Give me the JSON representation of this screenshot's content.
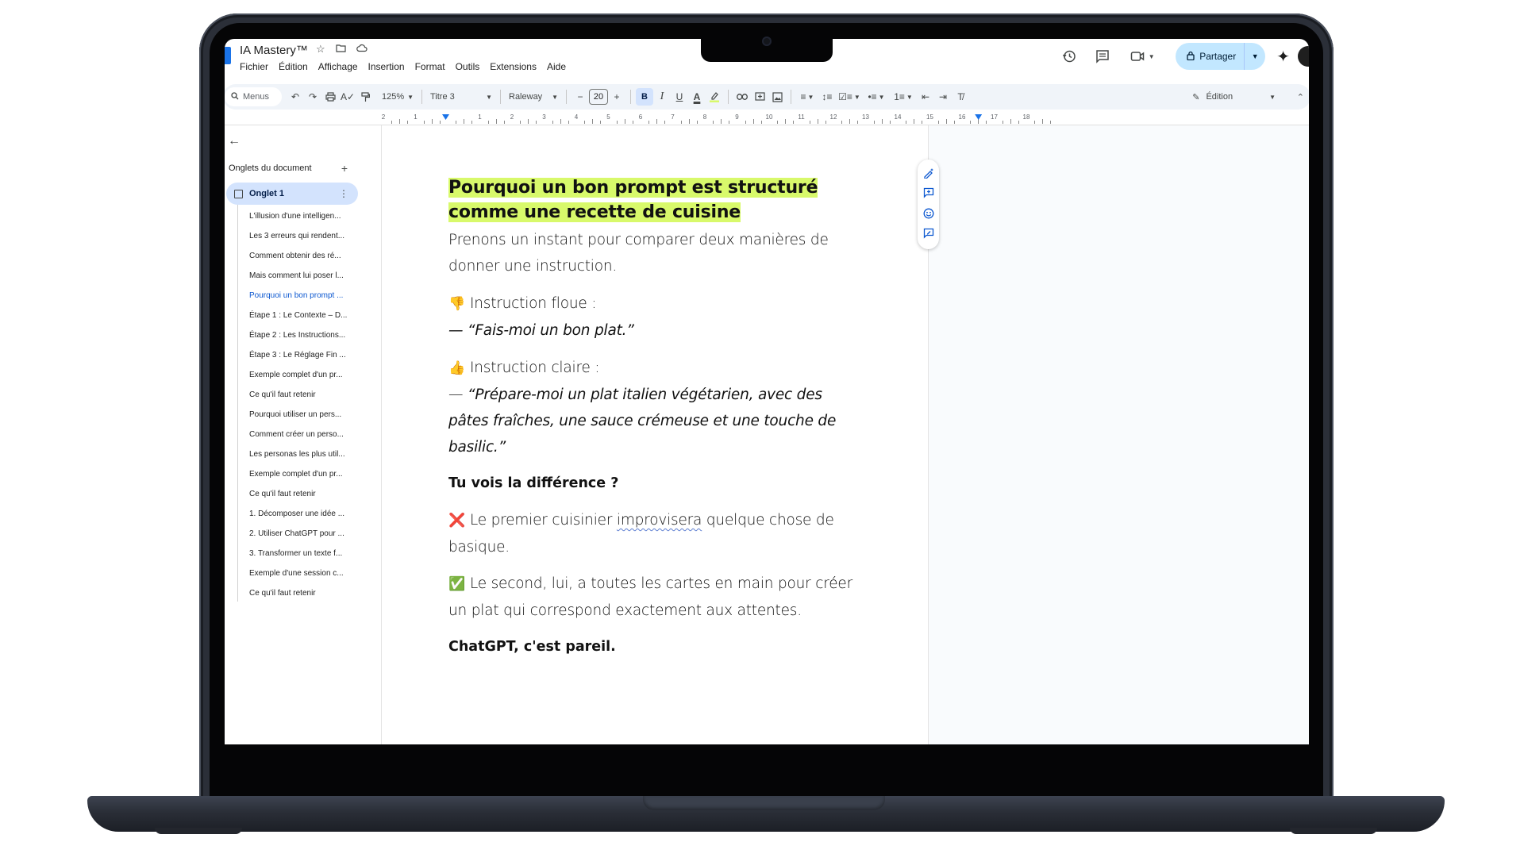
{
  "doc": {
    "title": "IA Mastery™",
    "menu": [
      "Fichier",
      "Édition",
      "Affichage",
      "Insertion",
      "Format",
      "Outils",
      "Extensions",
      "Aide"
    ],
    "share_label": "Partager"
  },
  "toolbar": {
    "search_placeholder": "Menus",
    "zoom": "125%",
    "style": "Titre 3",
    "font": "Raleway",
    "font_size": "20",
    "mode": "Édition"
  },
  "ruler": {
    "labels": [
      "2",
      "1",
      "",
      "1",
      "2",
      "3",
      "4",
      "5",
      "6",
      "7",
      "8",
      "9",
      "10",
      "11",
      "12",
      "13",
      "14",
      "15",
      "16",
      "17",
      "18"
    ]
  },
  "sidebar": {
    "header": "Onglets du document",
    "tab_label": "Onglet 1",
    "outline": [
      "L'illusion d'une intelligen...",
      "Les 3 erreurs qui rendent...",
      "Comment obtenir des ré...",
      "Mais comment lui poser l...",
      "Pourquoi un bon prompt ...",
      "Étape 1 : Le Contexte – D...",
      "Étape 2 : Les Instructions...",
      "Étape 3 : Le Réglage Fin ...",
      "Exemple complet d'un pr...",
      "Ce qu'il faut retenir",
      "Pourquoi utiliser un pers...",
      "Comment créer un perso...",
      "Les personas les plus util...",
      "Exemple complet d'un pr...",
      "Ce qu'il faut retenir",
      "1. Décomposer une idée ...",
      "2. Utiliser ChatGPT pour ...",
      "3. Transformer un texte f...",
      "Exemple d'une session c...",
      "Ce qu'il faut retenir"
    ],
    "active_index": 4
  },
  "content": {
    "heading": "Pourquoi un bon prompt est structuré comme une recette de cuisine",
    "intro": "Prenons un instant pour comparer deux manières de donner une instruction.",
    "vague_label": "Instruction floue :",
    "vague_quote": "— “Fais-moi un bon plat.”",
    "clear_label": "Instruction claire :",
    "clear_quote_dash": "— ",
    "clear_quote": "“Prépare-moi un plat italien végétarien, avec des pâtes fraîches, une sauce crémeuse et une touche de basilic.”",
    "difference": "Tu vois la différence ?",
    "first_cook_a": "Le premier cuisinier ",
    "first_cook_b": "improvisera",
    "first_cook_c": " quelque chose de basique.",
    "second_cook": "Le second, lui, a toutes les cartes en main pour créer un plat qui correspond exactement aux attentes.",
    "same": "ChatGPT, c'est pareil."
  },
  "icons": {
    "thumbs_down": "👎",
    "thumbs_up": "👍",
    "cross": "❌",
    "check": "✅"
  },
  "colors": {
    "highlight": "#d8f96b",
    "share_bg": "#c2e7ff",
    "active_tab": "#d3e3fd",
    "accent": "#0b57d0"
  }
}
